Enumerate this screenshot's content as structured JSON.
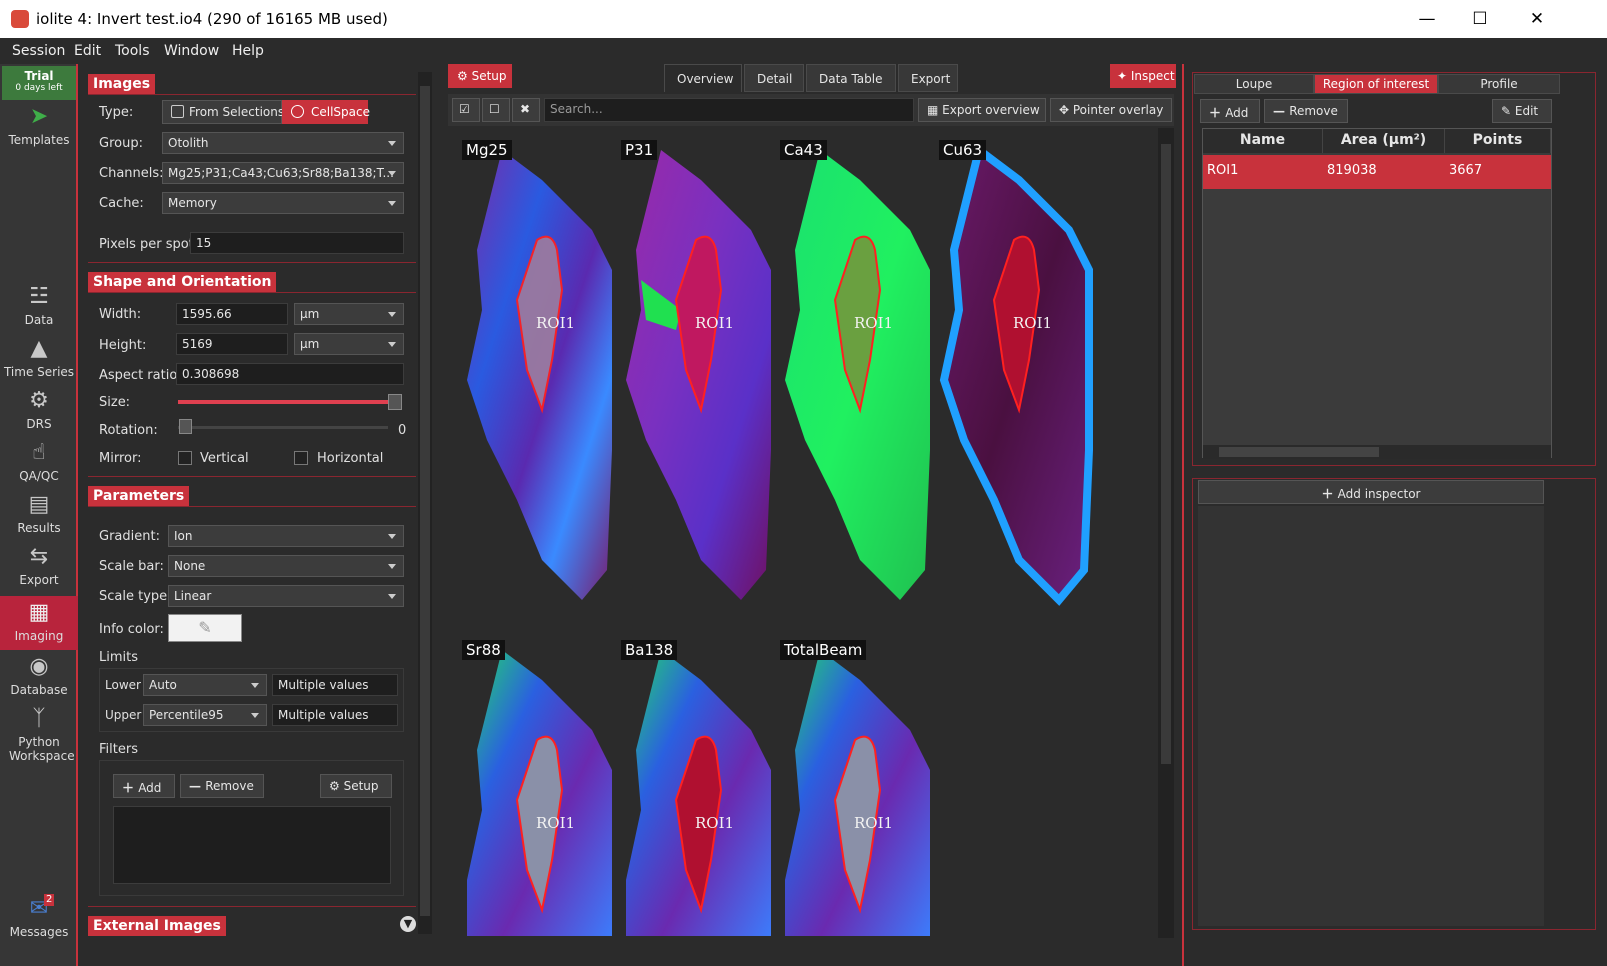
{
  "window": {
    "title": "iolite 4: Invert test.io4 (290 of 16165 MB used)",
    "minimize": "—",
    "maximize": "☐",
    "close": "✕"
  },
  "menu": [
    "Session",
    "Edit",
    "Tools",
    "Window",
    "Help"
  ],
  "trial": {
    "label": "Trial",
    "days": "0 days left"
  },
  "nav": {
    "templates": "Templates",
    "data": "Data",
    "timeseries": "Time Series",
    "drs": "DRS",
    "qaqc": "QA/QC",
    "results": "Results",
    "export": "Export",
    "imaging": "Imaging",
    "database": "Database",
    "python": "Python Workspace",
    "messages": "Messages",
    "messages_badge": "2"
  },
  "images": {
    "header": "Images",
    "type_label": "Type:",
    "from_selections": "From Selections",
    "cellspace": "CellSpace",
    "group_label": "Group:",
    "group_value": "Otolith",
    "channels_label": "Channels:",
    "channels_value": "Mg25;P31;Ca43;Cu63;Sr88;Ba138;T...",
    "cache_label": "Cache:",
    "cache_value": "Memory",
    "pps_label": "Pixels per spot:",
    "pps_value": "15"
  },
  "shape": {
    "header": "Shape and Orientation",
    "width_label": "Width:",
    "width_value": "1595.66",
    "width_unit": "µm",
    "height_label": "Height:",
    "height_value": "5169",
    "height_unit": "µm",
    "aspect_label": "Aspect ratio:",
    "aspect_value": "0.308698",
    "size_label": "Size:",
    "size_level": 0.98,
    "rotation_label": "Rotation:",
    "rotation_value": "0",
    "mirror_label": "Mirror:",
    "vertical": "Vertical",
    "horizontal": "Horizontal"
  },
  "params": {
    "header": "Parameters",
    "gradient_label": "Gradient:",
    "gradient_value": "Ion",
    "scalebar_label": "Scale bar:",
    "scalebar_value": "None",
    "scaletype_label": "Scale type:",
    "scaletype_value": "Linear",
    "infocolor_label": "Info color:",
    "limits_label": "Limits",
    "lower_label": "Lower",
    "lower_mode": "Auto",
    "lower_value": "Multiple values",
    "upper_label": "Upper",
    "upper_mode": "Percentile95",
    "upper_value": "Multiple values",
    "filters_label": "Filters",
    "add": "Add",
    "remove": "Remove",
    "setup": "Setup"
  },
  "external": {
    "header": "External Images"
  },
  "center": {
    "setup": "Setup",
    "inspect": "Inspect",
    "tabs": [
      "Overview",
      "Detail",
      "Data Table",
      "Export"
    ],
    "search_placeholder": "Search...",
    "export_overview": "Export overview",
    "pointer_overlay": "Pointer overlay",
    "channels": [
      "Mg25",
      "P31",
      "Ca43",
      "Cu63",
      "Sr88",
      "Ba138",
      "TotalBeam"
    ],
    "roi_label": "ROI1"
  },
  "right": {
    "tabs": [
      "Loupe",
      "Region of interest",
      "Profile"
    ],
    "add": "Add",
    "remove": "Remove",
    "edit": "Edit",
    "columns": [
      "Name",
      "Area (µm²)",
      "Points"
    ],
    "rows": [
      [
        "ROI1",
        "819038",
        "3667"
      ]
    ],
    "add_inspector": "Add inspector"
  },
  "colors": {
    "accent": "#c8323c",
    "trial": "#3d7a3d"
  }
}
